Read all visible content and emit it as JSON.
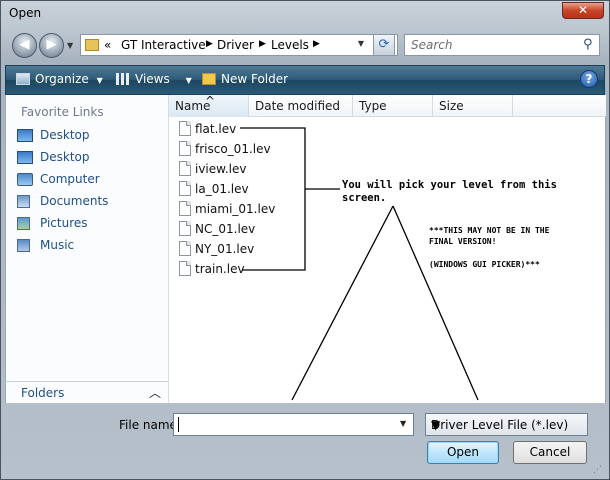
{
  "window": {
    "title": "Open",
    "close_glyph": "✕"
  },
  "nav": {
    "back_glyph": "◀",
    "forward_glyph": "▶",
    "breadcrumb_prefix": "«",
    "breadcrumbs": [
      "GT Interactive",
      "Driver",
      "Levels"
    ],
    "refresh_glyph": "⟳",
    "search_placeholder": "Search"
  },
  "toolbar": {
    "organize": "Organize",
    "views": "Views",
    "new_folder": "New Folder",
    "help_glyph": "?"
  },
  "sidebar": {
    "heading": "Favorite Links",
    "items": [
      {
        "label": "Desktop",
        "icon": "desktop-icon"
      },
      {
        "label": "Desktop",
        "icon": "desktop-icon"
      },
      {
        "label": "Computer",
        "icon": "computer-icon"
      },
      {
        "label": "Documents",
        "icon": "documents-icon"
      },
      {
        "label": "Pictures",
        "icon": "pictures-icon"
      },
      {
        "label": "Music",
        "icon": "music-icon"
      }
    ],
    "folders_label": "Folders"
  },
  "columns": [
    "Name",
    "Date modified",
    "Type",
    "Size"
  ],
  "files": [
    "flat.lev",
    "frisco_01.lev",
    "iview.lev",
    "la_01.lev",
    "miami_01.lev",
    "NC_01.lev",
    "NY_01.lev",
    "train.lev"
  ],
  "bottom": {
    "filename_label": "File name:",
    "filename_value": "",
    "filetype_value": "Driver Level File (*.lev)",
    "open_label": "Open",
    "cancel_label": "Cancel"
  },
  "annotations": {
    "pick_line1": "You will pick your level from this",
    "pick_line2": "screen.",
    "disclaimer_line1": "***THIS MAY NOT BE IN THE",
    "disclaimer_line2": "FINAL VERSION!",
    "disclaimer_line3": "(WINDOWS GUI PICKER)***"
  },
  "colors": {
    "link": "#1f4f88",
    "toolbar": "#2f5a78",
    "accent_button": "#bee6fd"
  }
}
